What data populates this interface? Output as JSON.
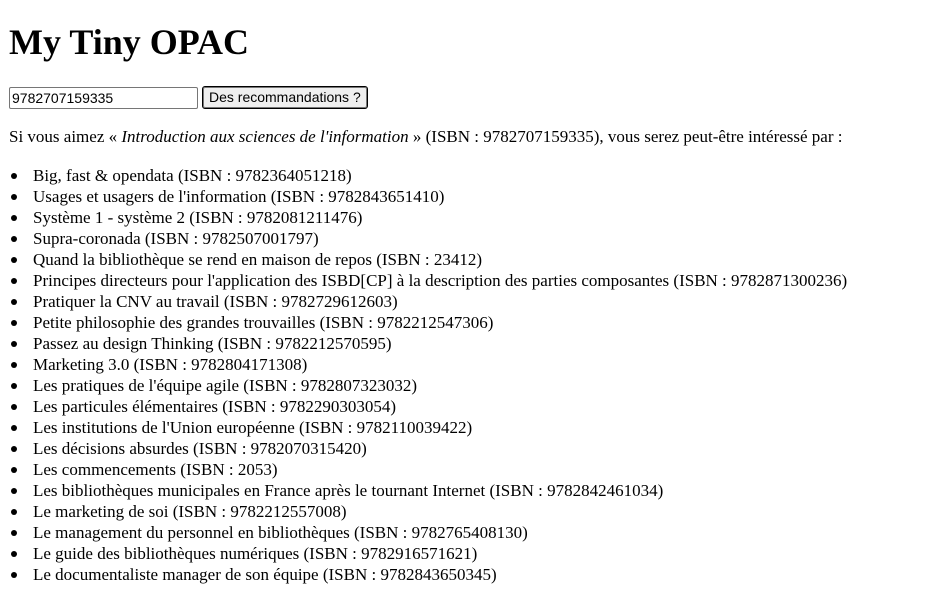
{
  "page": {
    "title": "My Tiny OPAC"
  },
  "search": {
    "isbn_value": "9782707159335",
    "button_label": "Des recommandations ?"
  },
  "intro": {
    "prefix": "Si vous aimez « ",
    "book_title": "Introduction aux sciences de l'information",
    "suffix": " » (ISBN : 9782707159335), vous serez peut-être intéressé par :"
  },
  "recommendations": [
    "Big, fast & opendata (ISBN : 9782364051218)",
    "Usages et usagers de l'information (ISBN : 9782843651410)",
    "Système 1 - système 2 (ISBN : 9782081211476)",
    "Supra-coronada (ISBN : 9782507001797)",
    "Quand la bibliothèque se rend en maison de repos (ISBN : 23412)",
    "Principes directeurs pour l'application des ISBD[CP] à la description des parties composantes (ISBN : 9782871300236)",
    "Pratiquer la CNV au travail (ISBN : 9782729612603)",
    "Petite philosophie des grandes trouvailles (ISBN : 9782212547306)",
    "Passez au design Thinking (ISBN : 9782212570595)",
    "Marketing 3.0 (ISBN : 9782804171308)",
    "Les pratiques de l'équipe agile (ISBN : 9782807323032)",
    "Les particules élémentaires (ISBN : 9782290303054)",
    "Les institutions de l'Union européenne (ISBN : 9782110039422)",
    "Les décisions absurdes (ISBN : 9782070315420)",
    "Les commencements (ISBN : 2053)",
    "Les bibliothèques municipales en France après le tournant Internet (ISBN : 9782842461034)",
    "Le marketing de soi (ISBN : 9782212557008)",
    "Le management du personnel en bibliothèques (ISBN : 9782765408130)",
    "Le guide des bibliothèques numériques (ISBN : 9782916571621)",
    "Le documentaliste manager de son équipe (ISBN : 9782843650345)"
  ]
}
